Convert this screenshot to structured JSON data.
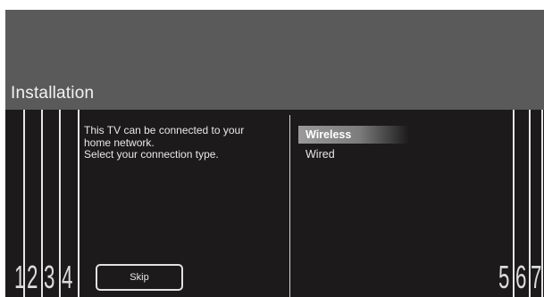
{
  "header": {
    "title": "Installation"
  },
  "message": {
    "lines": [
      "This TV can be connected to your",
      "home network.",
      "Select your connection type."
    ]
  },
  "options": [
    {
      "label": "Wireless",
      "selected": true
    },
    {
      "label": "Wired",
      "selected": false
    }
  ],
  "skip_label": "Skip",
  "callouts": [
    "1",
    "2",
    "3",
    "4",
    "5",
    "6",
    "7"
  ],
  "colors": {
    "background": "#1c1a1a",
    "header": "#5a5a5a",
    "highlight": "#8c8c8c",
    "text": "#e8e8e8"
  }
}
